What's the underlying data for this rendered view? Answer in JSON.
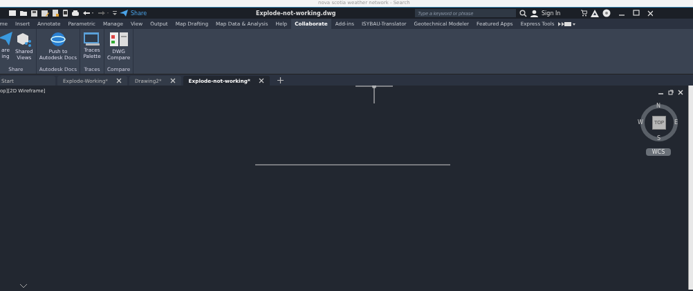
{
  "browser_strip": {
    "text": "nova scotia weather network - Search"
  },
  "title_bar": {
    "share": "Share",
    "title": "Explode-not-working.dwg",
    "search": {
      "placeholder": "Type a keyword or phrase"
    },
    "sign_in": "Sign In"
  },
  "ribbon_tabs": [
    {
      "label": "me",
      "selected": false
    },
    {
      "label": "Insert",
      "selected": false
    },
    {
      "label": "Annotate",
      "selected": false
    },
    {
      "label": "Parametric",
      "selected": false
    },
    {
      "label": "Manage",
      "selected": false
    },
    {
      "label": "View",
      "selected": false
    },
    {
      "label": "Output",
      "selected": false
    },
    {
      "label": "Map Drafting",
      "selected": false
    },
    {
      "label": "Map Data & Analysis",
      "selected": false
    },
    {
      "label": "Help",
      "selected": false
    },
    {
      "label": "Collaborate",
      "selected": true
    },
    {
      "label": "Add-ins",
      "selected": false
    },
    {
      "label": "ISYBAU-Translator",
      "selected": false
    },
    {
      "label": "Geotechnical Modeler",
      "selected": false
    },
    {
      "label": "Featured Apps",
      "selected": false
    },
    {
      "label": "Express Tools",
      "selected": false
    }
  ],
  "ribbon_panels": [
    {
      "title": "Share",
      "tools": [
        {
          "kind": "send",
          "label": "are\ning"
        },
        {
          "kind": "shared",
          "label": "Shared\nViews"
        }
      ]
    },
    {
      "title": "Autodesk Docs",
      "tools": [
        {
          "kind": "globe",
          "label": "Push to\nAutodesk Docs"
        }
      ]
    },
    {
      "title": "Traces",
      "tools": [
        {
          "kind": "traces",
          "label": "Traces\nPalette"
        }
      ]
    },
    {
      "title": "Compare",
      "tools": [
        {
          "kind": "compare",
          "label": "DWG\nCompare"
        }
      ]
    }
  ],
  "file_tabs": [
    {
      "label": "Start",
      "closable": false,
      "selected": false
    },
    {
      "label": "Explode-Working*",
      "closable": true,
      "selected": false
    },
    {
      "label": "Drawing2*",
      "closable": true,
      "selected": false
    },
    {
      "label": "Explode-not-working*",
      "closable": true,
      "selected": true
    }
  ],
  "viewport": {
    "label": "op][2D Wireframe]",
    "viewcube": {
      "top": "TOP",
      "n": "N",
      "s": "S",
      "e": "E",
      "w": "W"
    },
    "ucs": "WCS"
  }
}
